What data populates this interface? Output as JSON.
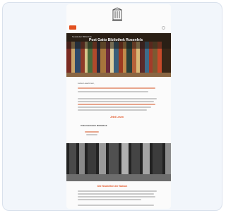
{
  "newsletter": {
    "hero_small": "Newsletter Bibliothek",
    "hero_title": "Post Gatto Bibliothek Rosenfels",
    "greeting": "Liebe Leserinnen,",
    "cta_label": "Jetzt Lesen",
    "mid_title": "Dokumentation Bibliothek",
    "section_title": "Die Neuheiten der Saison"
  },
  "colors": {
    "accent": "#e2501f",
    "background": "#f2f6fb",
    "card": "#fbfbfb"
  },
  "icons": {
    "logo": "library-crest-icon",
    "menu": "menu-icon",
    "search": "search-icon"
  }
}
